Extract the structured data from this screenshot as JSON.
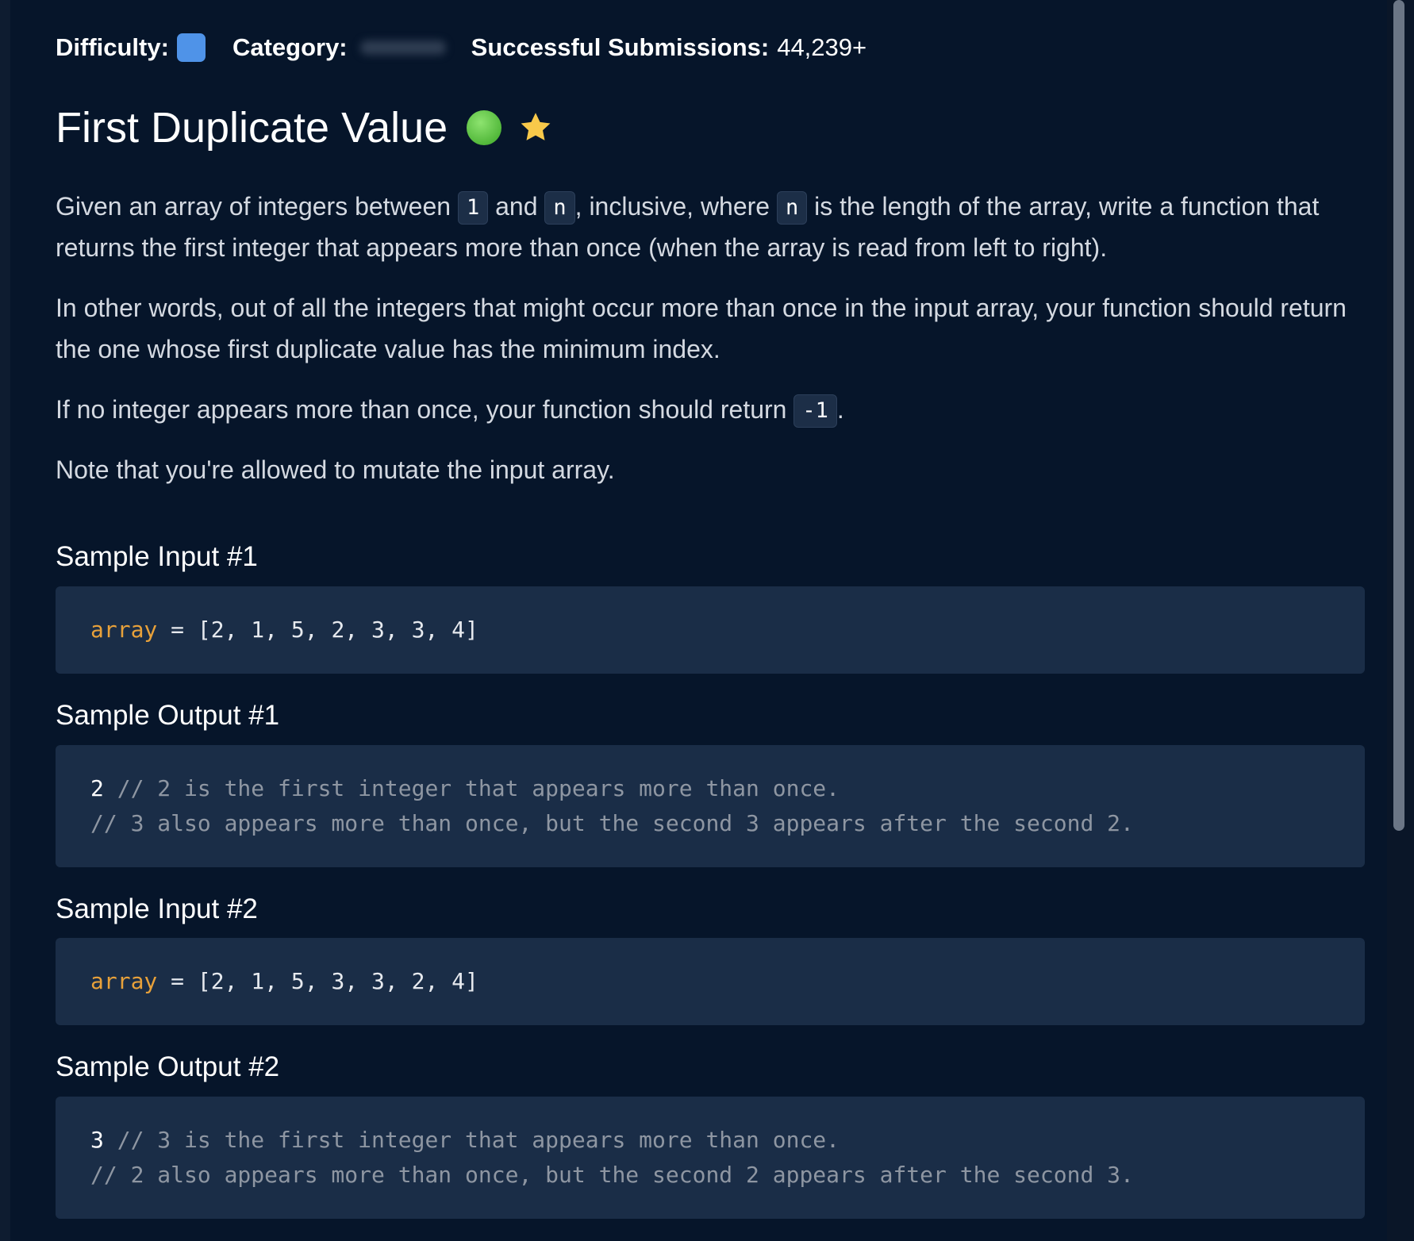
{
  "meta": {
    "difficulty_label": "Difficulty:",
    "category_label": "Category:",
    "submissions_label": "Successful Submissions:",
    "submissions_value": "44,239+",
    "difficulty_color": "#4f93e8"
  },
  "problem": {
    "title": "First Duplicate Value",
    "completed_icon": "green-circle-icon",
    "favorite_icon": "star-icon"
  },
  "description": {
    "p1": {
      "t1": "Given an array of integers between ",
      "c1": "1",
      "t2": " and ",
      "c2": "n",
      "t3": ", inclusive, where ",
      "c3": "n",
      "t4": " is the length of the array, write a function that returns the first integer that appears more than once (when the array is read from left to right)."
    },
    "p2": "In other words, out of all the integers that might occur more than once in the input array, your function should return the one whose first duplicate value has the minimum index.",
    "p3": {
      "t1": "If no integer appears more than once, your function should return ",
      "c1": "-1",
      "t2": "."
    },
    "p4": "Note that you're allowed to mutate the input array."
  },
  "samples": [
    {
      "input_heading": "Sample Input #1",
      "input_var": "array",
      "input_rest": " = [2, 1, 5, 2, 3, 3, 4]",
      "output_heading": "Sample Output #1",
      "output_value": "2",
      "output_comment_1": " // 2 is the first integer that appears more than once.",
      "output_comment_2": "// 3 also appears more than once, but the second 3 appears after the second 2."
    },
    {
      "input_heading": "Sample Input #2",
      "input_var": "array",
      "input_rest": " = [2, 1, 5, 3, 3, 2, 4]",
      "output_heading": "Sample Output #2",
      "output_value": "3",
      "output_comment_1": " // 3 is the first integer that appears more than once.",
      "output_comment_2": "// 2 also appears more than once, but the second 2 appears after the second 3."
    }
  ]
}
